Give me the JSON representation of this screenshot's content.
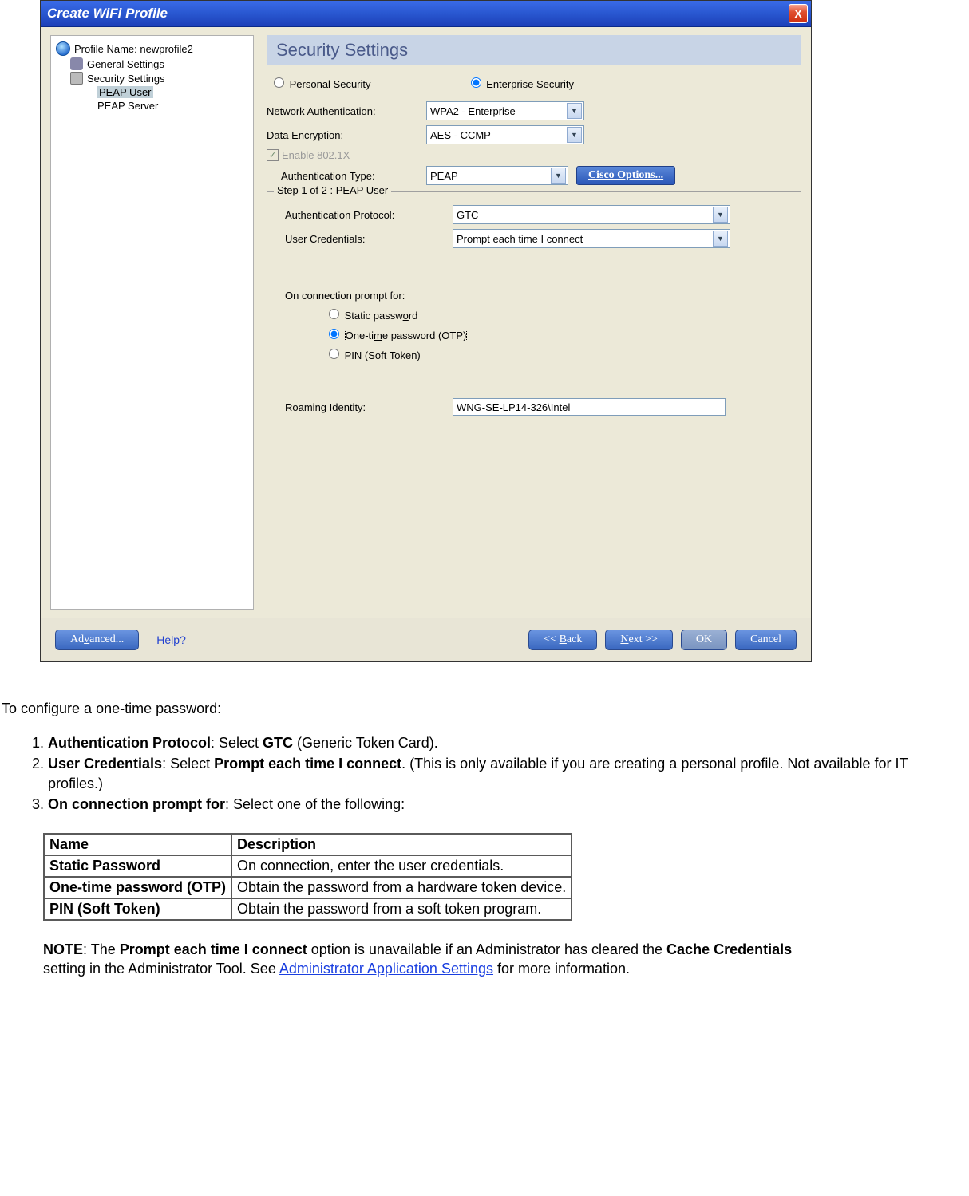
{
  "window": {
    "title": "Create WiFi Profile",
    "close_label": "X"
  },
  "tree": {
    "root": "Profile Name: newprofile2",
    "general": "General Settings",
    "security": "Security Settings",
    "peap_user": "PEAP User",
    "peap_server": "PEAP Server"
  },
  "main": {
    "heading": "Security Settings",
    "radio_personal": "Personal Security",
    "radio_enterprise": "Enterprise Security",
    "net_auth_label": "Network Authentication:",
    "net_auth_value": "WPA2 - Enterprise",
    "data_enc_label": "Data Encryption:",
    "data_enc_value": "AES - CCMP",
    "enable_8021x": "Enable 802.1X",
    "auth_type_label": "Authentication Type:",
    "auth_type_value": "PEAP",
    "cisco_btn": "Cisco Options...",
    "step_legend": "Step 1 of 2 : PEAP User",
    "auth_proto_label": "Authentication Protocol:",
    "auth_proto_value": "GTC",
    "user_cred_label": "User Credentials:",
    "user_cred_value": "Prompt each time I connect",
    "prompt_label": "On connection prompt for:",
    "opt_static": "Static password",
    "opt_otp": "One-time password (OTP)",
    "opt_pin": "PIN (Soft Token)",
    "roaming_label": "Roaming Identity:",
    "roaming_value": "WNG-SE-LP14-326\\Intel"
  },
  "buttons": {
    "advanced": "Advanced...",
    "help": "Help?",
    "back": "<< Back",
    "next": "Next >>",
    "ok": "OK",
    "cancel": "Cancel"
  },
  "doc": {
    "intro": "To configure a one-time password:",
    "li1_b": "Authentication Protocol",
    "li1_t": ": Select ",
    "li1_b2": "GTC",
    "li1_t2": " (Generic Token Card).",
    "li2_b": "User Credentials",
    "li2_t": ": Select ",
    "li2_b2": "Prompt each time I connect",
    "li2_t2": ". (This is only available if you are creating a personal profile. Not available for IT profiles.)",
    "li3_b": "On connection prompt for",
    "li3_t": ": Select one of the following:",
    "th_name": "Name",
    "th_desc": "Description",
    "r1n": "Static Password",
    "r1d": "On connection, enter the user credentials.",
    "r2n": "One-time password (OTP)",
    "r2d": "Obtain the password from a hardware token device.",
    "r3n": "PIN (Soft Token)",
    "r3d": "Obtain the password from a soft token program.",
    "note_b": "NOTE",
    "note_t1": ": The ",
    "note_b2": "Prompt each time I connect",
    "note_t2": " option is unavailable if an Administrator has cleared the ",
    "note_b3": "Cache Credentials",
    "note_t3": " setting in the Administrator Tool. See ",
    "note_link": "Administrator Application Settings",
    "note_t4": " for more information."
  }
}
